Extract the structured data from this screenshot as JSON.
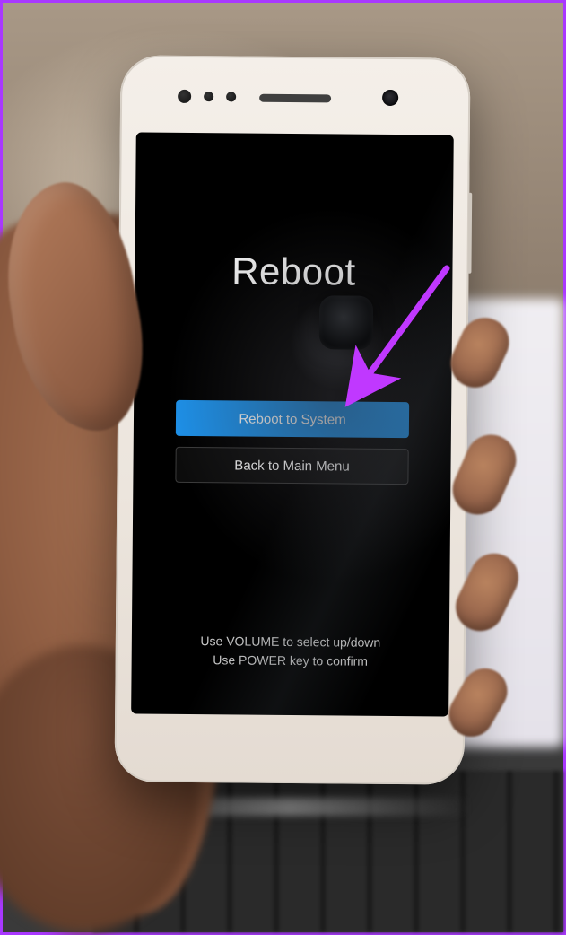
{
  "recovery": {
    "title": "Reboot",
    "options": [
      {
        "label": "Reboot to System",
        "selected": true
      },
      {
        "label": "Back to Main Menu",
        "selected": false
      }
    ],
    "hint_line1": "Use VOLUME to select up/down",
    "hint_line2": "Use POWER key to confirm"
  },
  "annotation": {
    "arrow_color": "#c038ff",
    "arrow_target": "reboot-to-system"
  },
  "colors": {
    "selected_bg": "#1d91ea",
    "frame_border": "#a938ff"
  }
}
